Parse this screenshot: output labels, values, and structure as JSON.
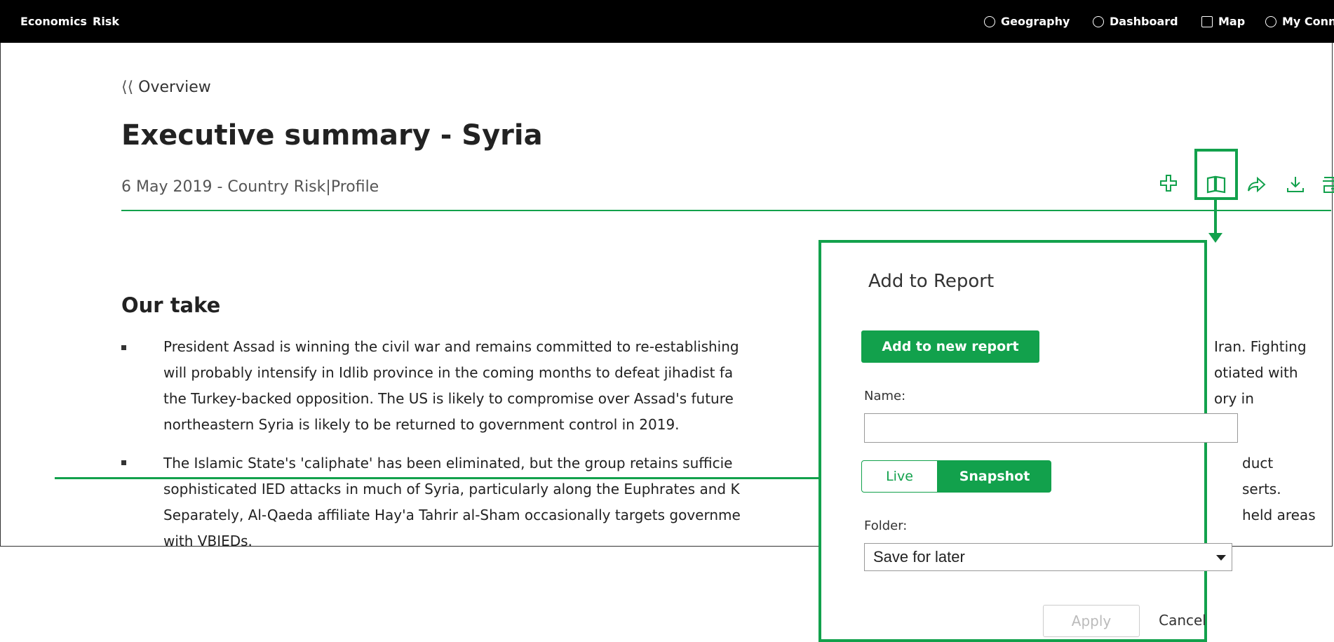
{
  "topnav": {
    "left": [
      "Economics",
      "Risk"
    ],
    "right": [
      {
        "label": "Geography",
        "icon": "globe-icon"
      },
      {
        "label": "Dashboard",
        "icon": "dashboard-icon"
      },
      {
        "label": "Map",
        "icon": "map-icon"
      },
      {
        "label": "My Connect",
        "icon": "my-icon"
      }
    ]
  },
  "breadcrumb": "Overview",
  "page": {
    "title": "Executive summary - Syria",
    "date": "6 May 2019 -",
    "category": "Country Risk",
    "separator": "|",
    "type": "Profile"
  },
  "toolbar_icons": [
    "add-icon",
    "add-to-report-icon",
    "share-icon",
    "download-icon",
    "print-icon"
  ],
  "section": {
    "heading": "Our take",
    "lines1": [
      [
        "President Assad is winning the civil war and remains committed to re-establishing",
        "Iran. Fighting"
      ],
      [
        "will probably intensify in Idlib province in the coming months to defeat jihadist fa",
        "otiated with"
      ],
      [
        "the Turkey-backed opposition. The US is likely to compromise over Assad's future",
        "ory in"
      ],
      [
        "northeastern Syria is likely to be returned to government control in 2019.",
        ""
      ]
    ],
    "lines2": [
      [
        "The Islamic State's 'caliphate' has been eliminated, but the group retains sufficie",
        "duct"
      ],
      [
        "sophisticated IED attacks in much of Syria, particularly along the Euphrates and K",
        "serts."
      ],
      [
        "Separately, Al-Qaeda affiliate Hay'a Tahrir al-Sham occasionally targets governme",
        "held areas"
      ],
      [
        "with VBIEDs.",
        ""
      ]
    ]
  },
  "dialog": {
    "title": "Add to Report",
    "add_new": "Add to new report",
    "name_label": "Name:",
    "name_value": "",
    "mode_live": "Live",
    "mode_snapshot": "Snapshot",
    "folder_label": "Folder:",
    "folder_value": "Save for later",
    "apply": "Apply",
    "cancel": "Cancel"
  },
  "colors": {
    "accent": "#12a14c",
    "topbar": "#000000"
  }
}
